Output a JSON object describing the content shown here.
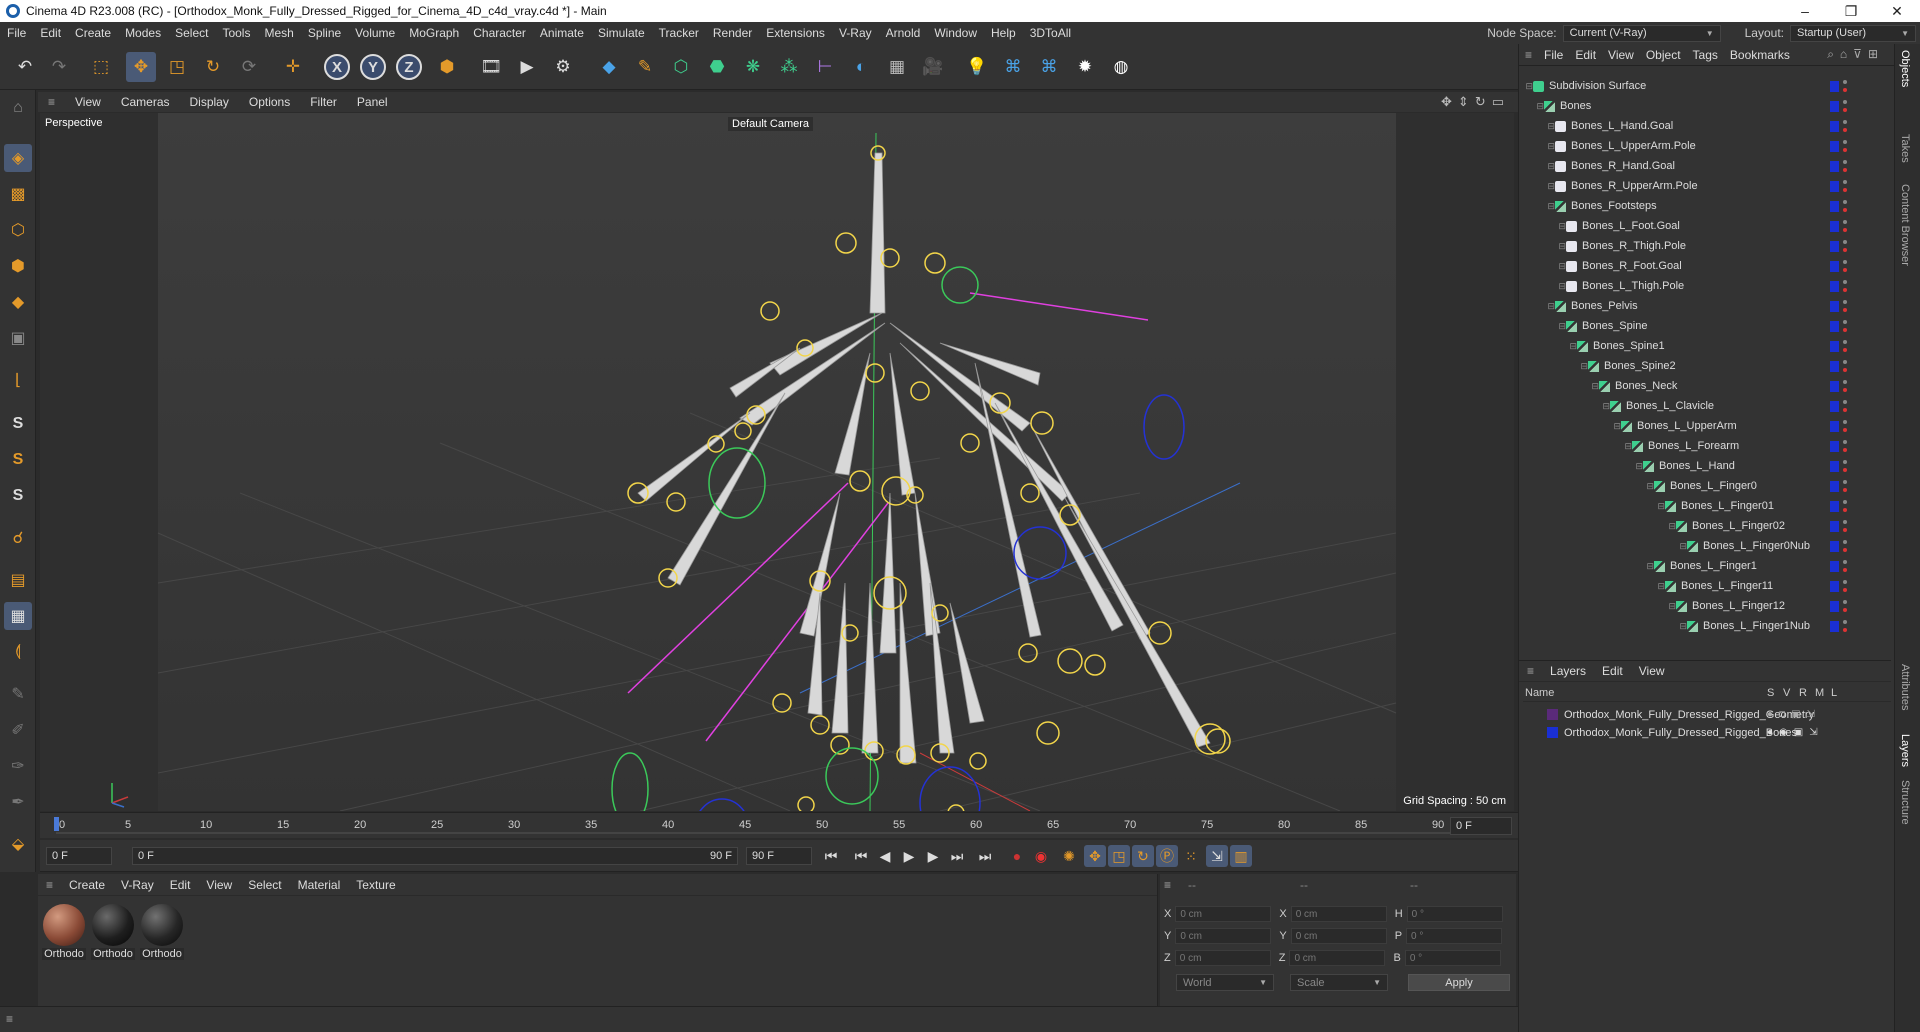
{
  "window": {
    "title": "Cinema 4D R23.008 (RC) - [Orthodox_Monk_Fully_Dressed_Rigged_for_Cinema_4D_c4d_vray.c4d *] - Main",
    "minimize": "–",
    "maximize": "❐",
    "close": "✕"
  },
  "menubar": {
    "items": [
      "File",
      "Edit",
      "Create",
      "Modes",
      "Select",
      "Tools",
      "Mesh",
      "Spline",
      "Volume",
      "MoGraph",
      "Character",
      "Animate",
      "Simulate",
      "Tracker",
      "Render",
      "Extensions",
      "V-Ray",
      "Arnold",
      "Window",
      "Help",
      "3DToAll"
    ],
    "node_space_label": "Node Space:",
    "node_space_value": "Current (V-Ray)",
    "layout_label": "Layout:",
    "layout_value": "Startup (User)"
  },
  "toolbar": {
    "axis_x": "X",
    "axis_y": "Y",
    "axis_z": "Z"
  },
  "left_tools": {
    "s1": "S",
    "s2": "S",
    "s3": "S"
  },
  "viewport": {
    "menu": [
      "View",
      "Cameras",
      "Display",
      "Options",
      "Filter",
      "Panel"
    ],
    "label": "Perspective",
    "camera": "Default Camera",
    "grid_spacing": "Grid Spacing : 50 cm"
  },
  "timeline": {
    "ticks": [
      "0",
      "5",
      "10",
      "15",
      "20",
      "25",
      "30",
      "35",
      "40",
      "45",
      "50",
      "55",
      "60",
      "65",
      "70",
      "75",
      "80",
      "85",
      "90"
    ],
    "current_frame": "0 F"
  },
  "transport": {
    "start": "0 F",
    "range_start": "0 F",
    "range_end": "90 F",
    "end": "90 F"
  },
  "material_manager": {
    "menu": [
      "Create",
      "V-Ray",
      "Edit",
      "View",
      "Select",
      "Material",
      "Texture"
    ],
    "materials": [
      {
        "name": "Orthodo",
        "color": "#8a4a36"
      },
      {
        "name": "Orthodo",
        "color": "#1e1e1e"
      },
      {
        "name": "Orthodo",
        "color": "#262626"
      }
    ]
  },
  "attributes": {
    "dashes": [
      "--",
      "--",
      "--"
    ],
    "rows": [
      {
        "a": "X",
        "av": "0 cm",
        "b": "X",
        "bv": "0 cm",
        "c": "H",
        "cv": "0 °"
      },
      {
        "a": "Y",
        "av": "0 cm",
        "b": "Y",
        "bv": "0 cm",
        "c": "P",
        "cv": "0 °"
      },
      {
        "a": "Z",
        "av": "0 cm",
        "b": "Z",
        "bv": "0 cm",
        "c": "B",
        "cv": "0 °"
      }
    ],
    "coord_system": "World",
    "mode": "Scale",
    "apply": "Apply"
  },
  "object_manager": {
    "menu": [
      "File",
      "Edit",
      "View",
      "Object",
      "Tags",
      "Bookmarks"
    ],
    "items": [
      {
        "name": "Subdivision Surface",
        "depth": 0
      },
      {
        "name": "Bones",
        "depth": 1
      },
      {
        "name": "Bones_L_Hand.Goal",
        "depth": 2
      },
      {
        "name": "Bones_L_UpperArm.Pole",
        "depth": 2
      },
      {
        "name": "Bones_R_Hand.Goal",
        "depth": 2
      },
      {
        "name": "Bones_R_UpperArm.Pole",
        "depth": 2
      },
      {
        "name": "Bones_Footsteps",
        "depth": 2
      },
      {
        "name": "Bones_L_Foot.Goal",
        "depth": 3
      },
      {
        "name": "Bones_R_Thigh.Pole",
        "depth": 3
      },
      {
        "name": "Bones_R_Foot.Goal",
        "depth": 3
      },
      {
        "name": "Bones_L_Thigh.Pole",
        "depth": 3
      },
      {
        "name": "Bones_Pelvis",
        "depth": 2
      },
      {
        "name": "Bones_Spine",
        "depth": 3
      },
      {
        "name": "Bones_Spine1",
        "depth": 4
      },
      {
        "name": "Bones_Spine2",
        "depth": 5
      },
      {
        "name": "Bones_Neck",
        "depth": 6
      },
      {
        "name": "Bones_L_Clavicle",
        "depth": 7
      },
      {
        "name": "Bones_L_UpperArm",
        "depth": 8
      },
      {
        "name": "Bones_L_Forearm",
        "depth": 9
      },
      {
        "name": "Bones_L_Hand",
        "depth": 10
      },
      {
        "name": "Bones_L_Finger0",
        "depth": 11
      },
      {
        "name": "Bones_L_Finger01",
        "depth": 12
      },
      {
        "name": "Bones_L_Finger02",
        "depth": 13
      },
      {
        "name": "Bones_L_Finger0Nub",
        "depth": 14
      },
      {
        "name": "Bones_L_Finger1",
        "depth": 11
      },
      {
        "name": "Bones_L_Finger11",
        "depth": 12
      },
      {
        "name": "Bones_L_Finger12",
        "depth": 13
      },
      {
        "name": "Bones_L_Finger1Nub",
        "depth": 14
      }
    ]
  },
  "layers": {
    "menu": [
      "Layers",
      "Edit",
      "View"
    ],
    "header_name": "Name",
    "header_cols": [
      "S",
      "V",
      "R",
      "M",
      "L"
    ],
    "items": [
      {
        "name": "Orthodox_Monk_Fully_Dressed_Rigged_Geometry",
        "color": "#5a2a7a"
      },
      {
        "name": "Orthodox_Monk_Fully_Dressed_Rigged_Bones",
        "color": "#1a2fd4"
      }
    ]
  },
  "side_tabs": [
    "Objects",
    "Takes",
    "Content Browser",
    "Attributes",
    "Layers",
    "Structure"
  ]
}
